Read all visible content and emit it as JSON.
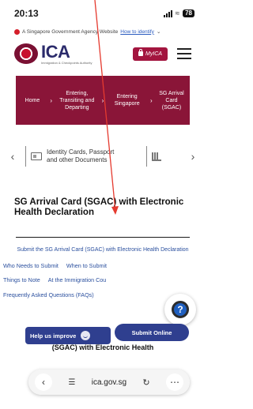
{
  "status_bar": {
    "time": "20:13",
    "battery": "78"
  },
  "gov_banner": {
    "text": "A Singapore Government Agency Website",
    "identify_link": "How to identify"
  },
  "header": {
    "logo_text": "ICA",
    "logo_subtext": "Immigration & Checkpoints Authority",
    "myica_label": "MyICA"
  },
  "breadcrumb": [
    {
      "label": "Home"
    },
    {
      "label": "Entering, Transiting and Departing"
    },
    {
      "label": "Entering Singapore"
    },
    {
      "label": "SG Arrival Card (SGAC)"
    }
  ],
  "carousel": {
    "item_label": "Identity Cards, Passport and other Documents"
  },
  "page": {
    "title": "SG Arrival Card (SGAC) with Electronic Health Declaration"
  },
  "section_links": {
    "first": "Submit the SG Arrival Card (SGAC) with Electronic Health Declaration",
    "row1": [
      "Who Needs to Submit",
      "When to Submit"
    ],
    "row2": [
      "Things to Note",
      "At the Immigration Cou"
    ],
    "faq": "Frequently Asked Questions (FAQs)"
  },
  "buttons": {
    "help_label": "Help us improve",
    "submit_label": "Submit Online"
  },
  "footer_title": "(SGAC) with Electronic Health",
  "browser": {
    "url": "ica.gov.sg"
  },
  "colors": {
    "brand_maroon": "#8a1538",
    "button_navy": "#2f3f8f",
    "link_blue": "#2a4f9e",
    "annotation_red": "#e53a2f"
  }
}
